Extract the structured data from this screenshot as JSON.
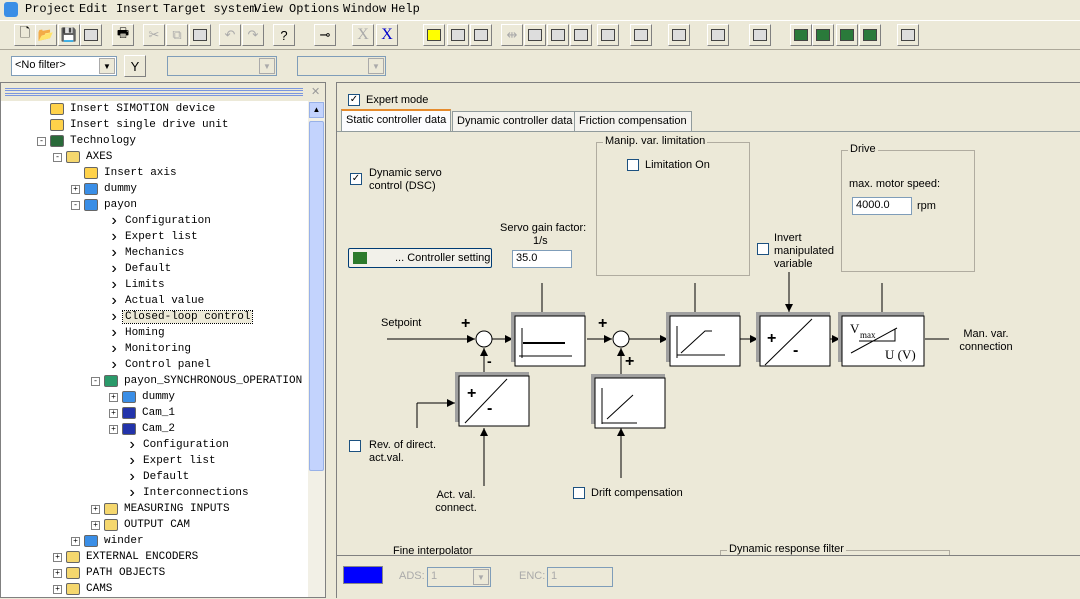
{
  "menu": [
    "Project",
    "Edit",
    "Insert",
    "Target system",
    "View",
    "Options",
    "Window",
    "Help"
  ],
  "toolbar": {
    "icons": [
      "new-icon",
      "open-icon",
      "save-icon",
      "save-compile-icon",
      "print-icon",
      "cut-icon",
      "copy-icon",
      "paste-icon",
      "undo-icon",
      "redo-icon",
      "help-icon",
      "connect-icon",
      "xi-icon",
      "xe-icon",
      "network-icon",
      "download-icon",
      "network2-icon",
      "split-icon",
      "load-icon",
      "upload-icon",
      "loaddown-icon",
      "view-icon",
      "upload2-icon",
      "monitor-icon",
      "info-icon",
      "user-icon",
      "trace1-icon",
      "trace2-icon",
      "trace3-icon",
      "trace4-icon",
      "grid-icon"
    ],
    "xi_label": "X",
    "xe_label": "X"
  },
  "filter": {
    "value": "<No filter>"
  },
  "tree": [
    {
      "label": "Insert SIMOTION device",
      "depth": 2,
      "icon": "insert-icon",
      "exp": ""
    },
    {
      "label": "Insert single drive unit",
      "depth": 2,
      "icon": "insert-icon",
      "exp": ""
    },
    {
      "label": "Technology",
      "depth": 2,
      "icon": "technology-icon",
      "exp": "-"
    },
    {
      "label": "AXES",
      "depth": 3,
      "icon": "folder-icon",
      "exp": "-"
    },
    {
      "label": "Insert axis",
      "depth": 4,
      "icon": "insert-icon",
      "exp": ""
    },
    {
      "label": "dummy",
      "depth": 4,
      "icon": "axis-icon",
      "exp": "+"
    },
    {
      "label": "payon",
      "depth": 4,
      "icon": "axis-icon",
      "exp": "-"
    },
    {
      "label": "Configuration",
      "depth": 5,
      "icon": "chevron-icon",
      "exp": ""
    },
    {
      "label": "Expert list",
      "depth": 5,
      "icon": "chevron-icon",
      "exp": ""
    },
    {
      "label": "Mechanics",
      "depth": 5,
      "icon": "chevron-icon",
      "exp": ""
    },
    {
      "label": "Default",
      "depth": 5,
      "icon": "chevron-icon",
      "exp": ""
    },
    {
      "label": "Limits",
      "depth": 5,
      "icon": "chevron-icon",
      "exp": ""
    },
    {
      "label": "Actual value",
      "depth": 5,
      "icon": "chevron-icon",
      "exp": ""
    },
    {
      "label": "Closed-loop control",
      "depth": 5,
      "icon": "chevron-icon",
      "exp": "",
      "selected": true
    },
    {
      "label": "Homing",
      "depth": 5,
      "icon": "chevron-icon",
      "exp": ""
    },
    {
      "label": "Monitoring",
      "depth": 5,
      "icon": "chevron-icon",
      "exp": ""
    },
    {
      "label": "Control panel",
      "depth": 5,
      "icon": "chevron-icon",
      "exp": ""
    },
    {
      "label": "payon_SYNCHRONOUS_OPERATION",
      "depth": 5,
      "icon": "sync-icon",
      "exp": "-"
    },
    {
      "label": "dummy",
      "depth": 6,
      "icon": "axis-icon",
      "exp": "+"
    },
    {
      "label": "Cam_1",
      "depth": 6,
      "icon": "cam-icon",
      "exp": "+"
    },
    {
      "label": "Cam_2",
      "depth": 6,
      "icon": "cam-icon",
      "exp": "+"
    },
    {
      "label": "Configuration",
      "depth": 6,
      "icon": "chevron-icon",
      "exp": ""
    },
    {
      "label": "Expert list",
      "depth": 6,
      "icon": "chevron-icon",
      "exp": ""
    },
    {
      "label": "Default",
      "depth": 6,
      "icon": "chevron-icon",
      "exp": ""
    },
    {
      "label": "Interconnections",
      "depth": 6,
      "icon": "chevron-icon",
      "exp": ""
    },
    {
      "label": "MEASURING INPUTS",
      "depth": 5,
      "icon": "folder-icon",
      "exp": "+"
    },
    {
      "label": "OUTPUT CAM",
      "depth": 5,
      "icon": "folder-icon",
      "exp": "+"
    },
    {
      "label": "winder",
      "depth": 4,
      "icon": "axis-icon",
      "exp": "+"
    },
    {
      "label": "EXTERNAL ENCODERS",
      "depth": 3,
      "icon": "folder-icon",
      "exp": "+"
    },
    {
      "label": "PATH OBJECTS",
      "depth": 3,
      "icon": "folder-icon",
      "exp": "+"
    },
    {
      "label": "CAMS",
      "depth": 3,
      "icon": "folder-icon",
      "exp": "+"
    }
  ],
  "panel": {
    "expert_mode": "Expert mode",
    "tabs": [
      "Static controller data",
      "Dynamic controller data",
      "Friction compensation"
    ],
    "dsc": "Dynamic servo control (DSC)",
    "controller_setting": "... Controller setting",
    "servo_gain_label": "Servo gain factor:",
    "servo_gain_unit": "1/s",
    "servo_gain_value": "35.0",
    "manip_group": "Manip. var. limitation",
    "limitation_on": "Limitation On",
    "invert": "Invert manipulated variable",
    "drive_group": "Drive",
    "max_speed_label": "max. motor speed:",
    "max_speed_value": "4000.0",
    "max_speed_unit": "rpm",
    "setpoint": "Setpoint",
    "rev_direct": "Rev. of direct. act.val.",
    "act_val": "Act. val. connect.",
    "drift": "Drift compensation",
    "man_var": "Man. var. connection",
    "vmax": "V",
    "vmax_sub": "max",
    "uv": "U (V)",
    "fine_interp": "Fine interpolator",
    "dyn_filter": "Dynamic response filter",
    "ads_label": "ADS:",
    "ads_value": "1",
    "enc_label": "ENC:",
    "enc_value": "1",
    "color_swatch": "#0000ff"
  }
}
